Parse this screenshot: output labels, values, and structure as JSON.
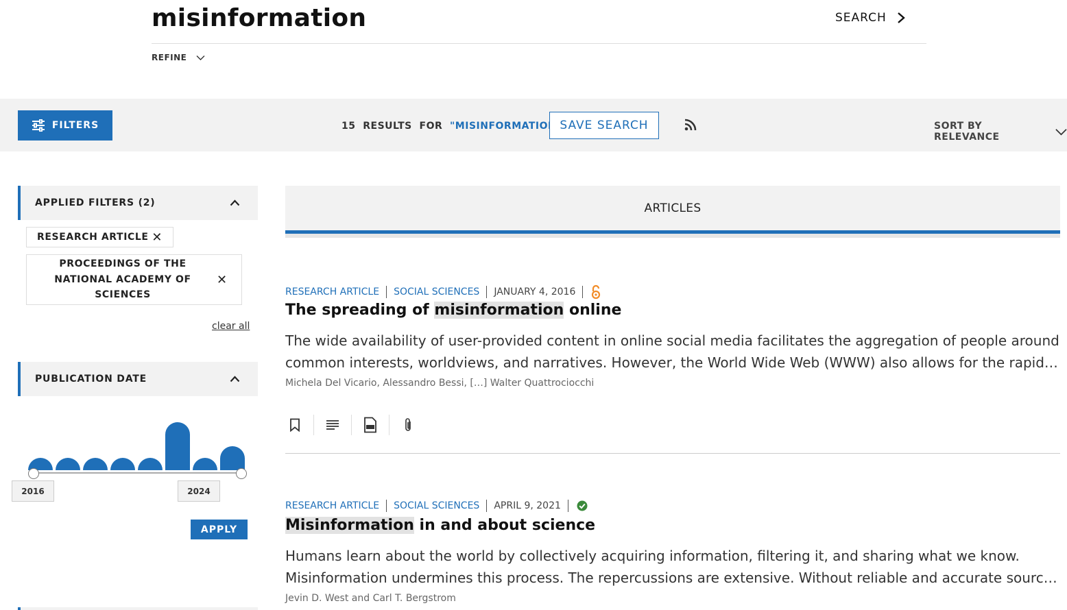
{
  "search": {
    "query": "misinformation",
    "search_label": "SEARCH",
    "refine_label": "REFINE"
  },
  "toolbar": {
    "filters_label": "FILTERS",
    "results_count": "15",
    "results_word": "RESULTS",
    "for_word": "FOR",
    "results_term": "\"MISINFORMATION\"",
    "save_search_label": "SAVE SEARCH",
    "sort_label": "SORT BY RELEVANCE"
  },
  "sidebar": {
    "applied_filters_label": "APPLIED FILTERS (2)",
    "chips": [
      {
        "label": "RESEARCH ARTICLE"
      },
      {
        "label": "PROCEEDINGS OF THE NATIONAL ACADEMY OF SCIENCES"
      }
    ],
    "clear_all_label": "clear all",
    "publication_date_label": "PUBLICATION DATE",
    "histogram_levels": [
      0.26,
      0.26,
      0.26,
      0.26,
      0.26,
      1.0,
      0.26,
      0.5
    ],
    "year_start": "2016",
    "year_end": "2024",
    "apply_label": "APPLY"
  },
  "main": {
    "tab_label": "ARTICLES",
    "articles": [
      {
        "type": "RESEARCH ARTICLE",
        "section": "SOCIAL SCIENCES",
        "date": "JANUARY 4, 2016",
        "access_icon": "open-access-icon",
        "title_before": "The spreading of ",
        "title_highlight": "misinformation",
        "title_after": " online",
        "abstract_line1": "The wide availability of user-provided content in online social media facilitates the aggregation of people around",
        "abstract_line2": "common interests, worldviews, and narratives. However, the World Wide Web (WWW) also allows for the rapid…",
        "authors": "Michela Del Vicario, Alessandro Bessi, […] Walter Quattrociocchi"
      },
      {
        "type": "RESEARCH ARTICLE",
        "section": "SOCIAL SCIENCES",
        "date": "APRIL 9, 2021",
        "access_icon": "check-circle-icon",
        "title_before": "",
        "title_highlight": "Misinformation",
        "title_after": " in and about science",
        "abstract_line1": "Humans learn about the world by collectively acquiring information, filtering it, and sharing what we know.",
        "abstract_line2": "Misinformation undermines this process. The repercussions are extensive. Without reliable and accurate sources o…",
        "authors": "Jevin D. West and Carl T. Bergstrom"
      }
    ]
  },
  "colors": {
    "accent": "#1f6fb8",
    "open_access": "#f28c28",
    "free_check": "#3a8a3a",
    "band": "#f2f2f2"
  }
}
